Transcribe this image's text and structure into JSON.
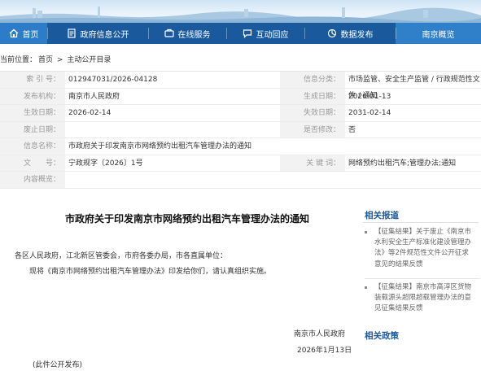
{
  "nav": {
    "items": [
      {
        "label": "首页",
        "icon": "home-icon"
      },
      {
        "label": "政府信息公开",
        "icon": "document-icon"
      },
      {
        "label": "在线服务",
        "icon": "service-icon"
      },
      {
        "label": "互动回应",
        "icon": "chat-icon"
      },
      {
        "label": "数据发布",
        "icon": "chart-icon"
      },
      {
        "label": "南京概览",
        "icon": "none"
      }
    ]
  },
  "breadcrumb": {
    "prefix": "当前位置：",
    "home": "首页",
    "sep": ">",
    "current": "主动公开目录"
  },
  "meta": {
    "index_label": "索 引 号：",
    "index_value": "012947031/2026-04128",
    "category_label": "信息分类：",
    "category_value": "市场监管、安全生产监管 / 行政规范性文件 / 通知",
    "publisher_label": "发布机构：",
    "publisher_value": "南京市人民政府",
    "created_label": "生成日期：",
    "created_value": "2026-01-13",
    "effective_label": "生效日期：",
    "effective_value": "2026-02-14",
    "expiry_label": "失效日期：",
    "expiry_value": "2031-02-14",
    "repeal_label": "废止日期：",
    "repeal_value": "",
    "modified_label": "是否修改：",
    "modified_value": "否",
    "name_label": "信息名称：",
    "name_value": "市政府关于印发南京市网络预约出租汽车管理办法的通知",
    "docno_label": "文　　号：",
    "docno_value": "宁政规字〔2026〕1号",
    "keywords_label": "关 键 词：",
    "keywords_value": "网络预约出租汽车;管理办法;通知",
    "summary_label": "内容概览：",
    "summary_value": ""
  },
  "article": {
    "title": "市政府关于印发南京市网络预约出租汽车管理办法的通知",
    "recipients": "各区人民政府，江北新区管委会，市府各委办局，市各直属单位：",
    "body": "现将《南京市网络预约出租汽车管理办法》印发给你们，请认真组织实施。",
    "signer": "南京市人民政府",
    "date": "2026年1月13日",
    "note": "(此件公开发布)"
  },
  "sidebar": {
    "related_heading": "相关报道",
    "related_items": [
      {
        "lines": [
          "【征集结果】关于废止《南京市",
          "水利安全生产标准化建设管理办",
          "法》等2件规范性文件公开征求",
          "意见的结果反馈"
        ]
      },
      {
        "lines": [
          "【征集结果】南京市高淳区货物",
          "装载源头超限超载管理办法的意",
          "见征集结果反馈"
        ]
      }
    ],
    "policy_heading": "相关政策"
  },
  "colors": {
    "nav_bg": "#1a5a9c",
    "nav_active": "#2c7cc7",
    "accent": "#1a5a9c"
  }
}
